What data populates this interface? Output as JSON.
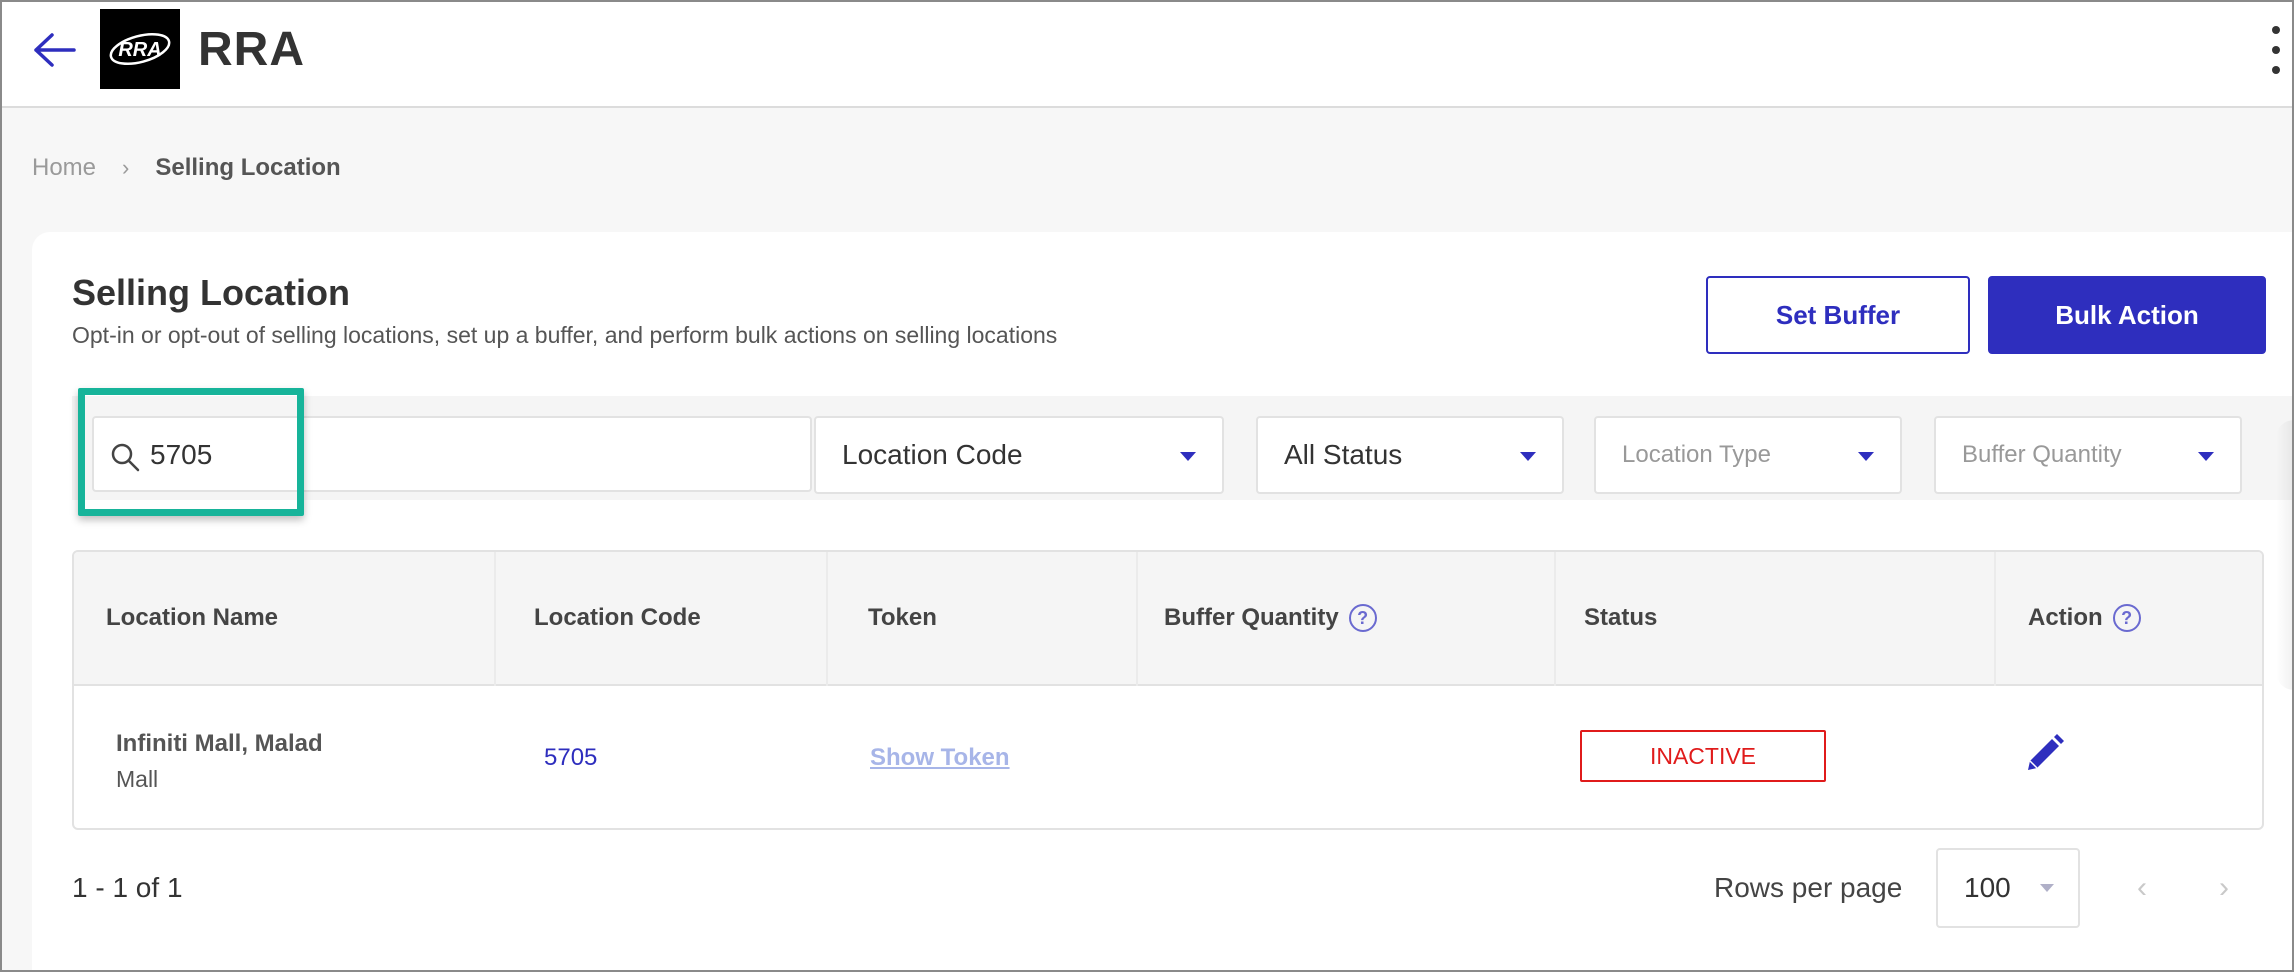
{
  "header": {
    "app_title": "RRA",
    "logo_text": "RRA"
  },
  "breadcrumb": {
    "home": "Home",
    "separator": "›",
    "current": "Selling Location"
  },
  "page": {
    "title": "Selling Location",
    "subtitle": "Opt-in or opt-out of selling locations, set up a buffer, and perform bulk actions on selling locations"
  },
  "actions": {
    "set_buffer": "Set Buffer",
    "bulk_action": "Bulk Action"
  },
  "filters": {
    "search_value": "5705",
    "search_by": "Location Code",
    "status": "All Status",
    "location_type_placeholder": "Location Type",
    "buffer_quantity_placeholder": "Buffer Quantity"
  },
  "table": {
    "columns": {
      "location_name": "Location Name",
      "location_code": "Location Code",
      "token": "Token",
      "buffer_quantity": "Buffer Quantity",
      "status": "Status",
      "action": "Action"
    },
    "help_glyph": "?",
    "rows": [
      {
        "location_name": "Infiniti Mall, Malad",
        "location_type": "Mall",
        "location_code": "5705",
        "token_link": "Show Token",
        "buffer_quantity": "",
        "status": "INACTIVE"
      }
    ]
  },
  "pagination": {
    "range": "1 - 1 of 1",
    "rows_per_page_label": "Rows per page",
    "rows_per_page": "100",
    "prev_glyph": "‹",
    "next_glyph": "›"
  },
  "colors": {
    "primary": "#2e2ebe",
    "highlight": "#17b49a",
    "inactive": "#e01b1b"
  }
}
